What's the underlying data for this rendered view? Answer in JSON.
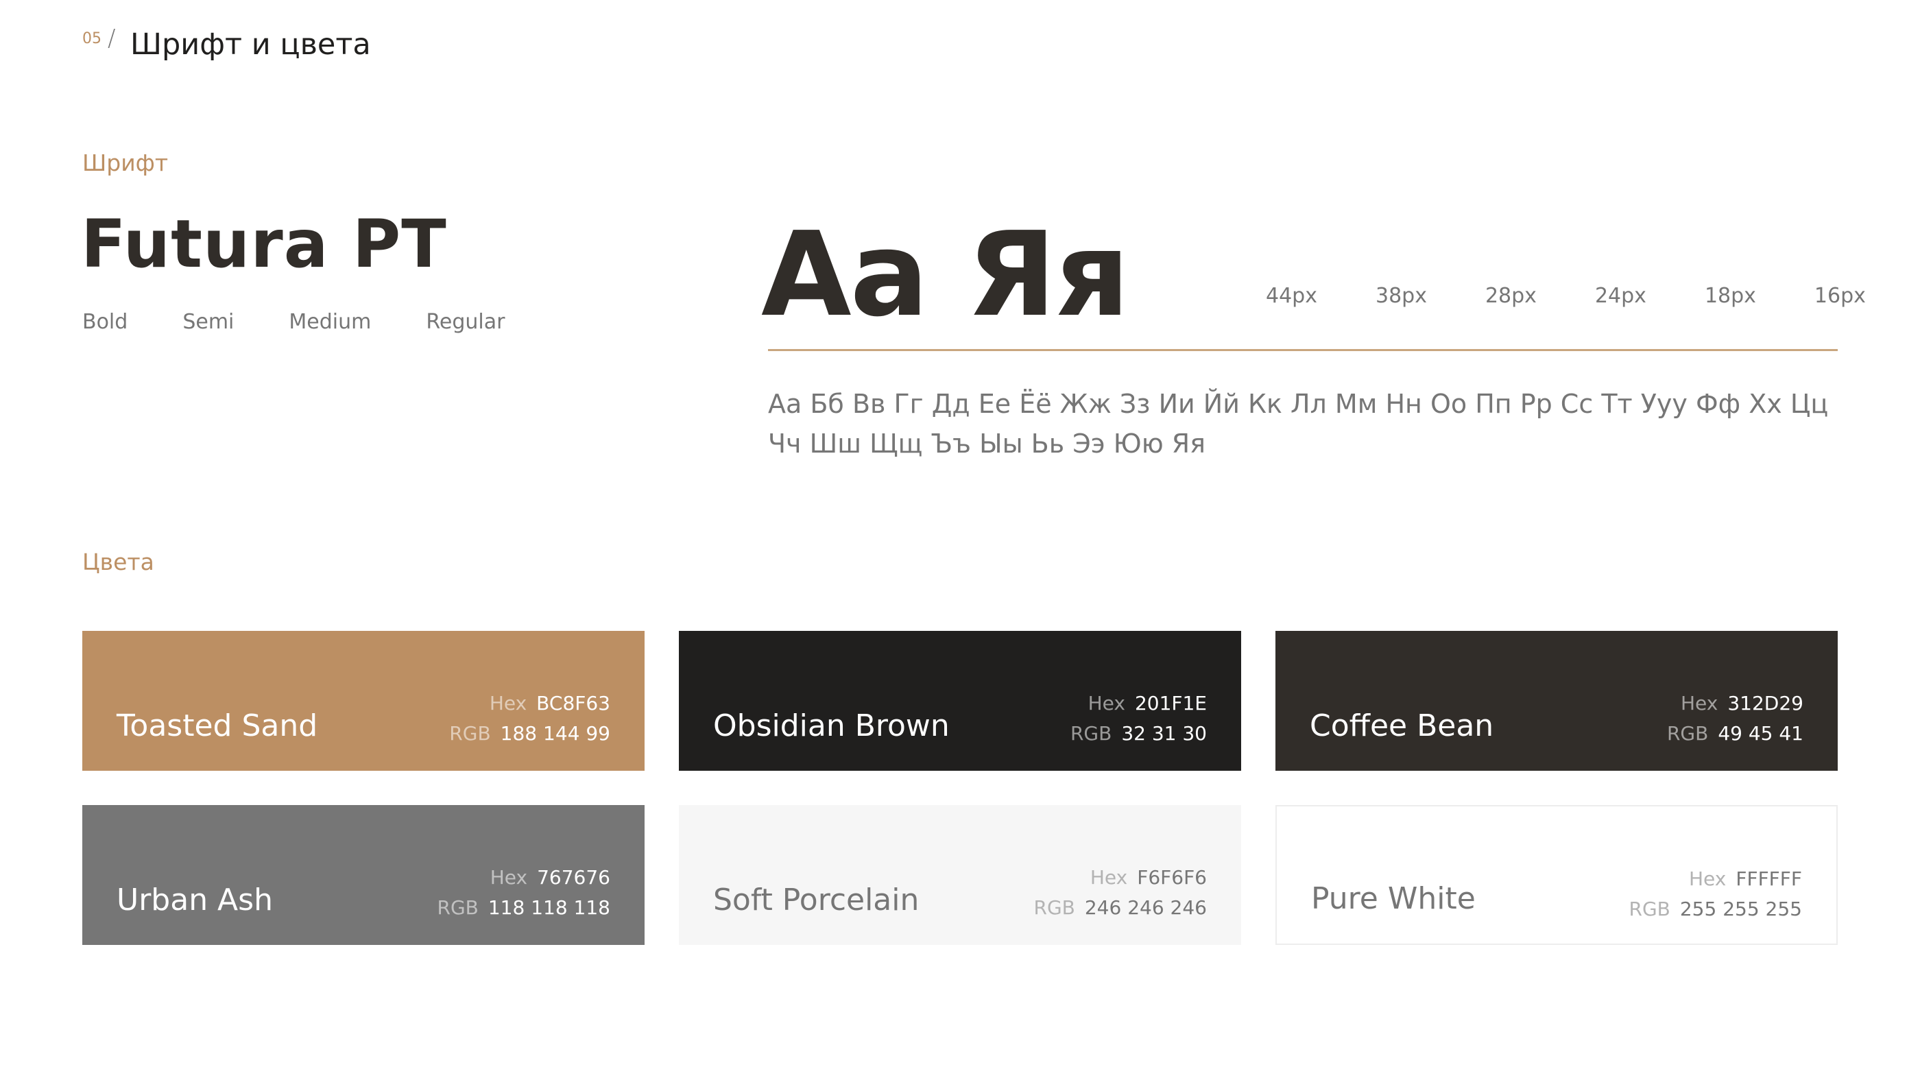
{
  "header": {
    "number": "05",
    "separator": "/",
    "title": "Шрифт и цвета"
  },
  "font": {
    "section_label": "Шрифт",
    "family": "Futura PT",
    "weights": [
      "Bold",
      "Semi",
      "Medium",
      "Regular"
    ],
    "sample": "Аа Яя",
    "sizes": [
      "44px",
      "38px",
      "28px",
      "24px",
      "18px",
      "16px"
    ],
    "alphabet": "Аа Бб Вв Гг Дд Ее Ёё Жж Зз Ии Йй Кк Лл Мм Нн Оо Пп Рр Сс Тт Ууу Фф Хх Цц Чч Шш Щщ Ъъ Ыы Ьь Ээ Юю Яя"
  },
  "colors": {
    "section_label": "Цвета",
    "hex_label": "Hex",
    "rgb_label": "RGB",
    "swatches": [
      {
        "name": "Toasted Sand",
        "hex": "BC8F63",
        "rgb": "188 144 99",
        "color": "#BC8F63"
      },
      {
        "name": "Obsidian Brown",
        "hex": "201F1E",
        "rgb": "32 31 30",
        "color": "#201F1E"
      },
      {
        "name": "Coffee Bean",
        "hex": "312D29",
        "rgb": "49 45 41",
        "color": "#312D29"
      },
      {
        "name": "Urban Ash",
        "hex": "767676",
        "rgb": "118 118 118",
        "color": "#767676"
      },
      {
        "name": "Soft Porcelain",
        "hex": "F6F6F6",
        "rgb": "246 246 246",
        "color": "#F6F6F6"
      },
      {
        "name": "Pure White",
        "hex": "FFFFFF",
        "rgb": "255 255 255",
        "color": "#FFFFFF"
      }
    ]
  }
}
